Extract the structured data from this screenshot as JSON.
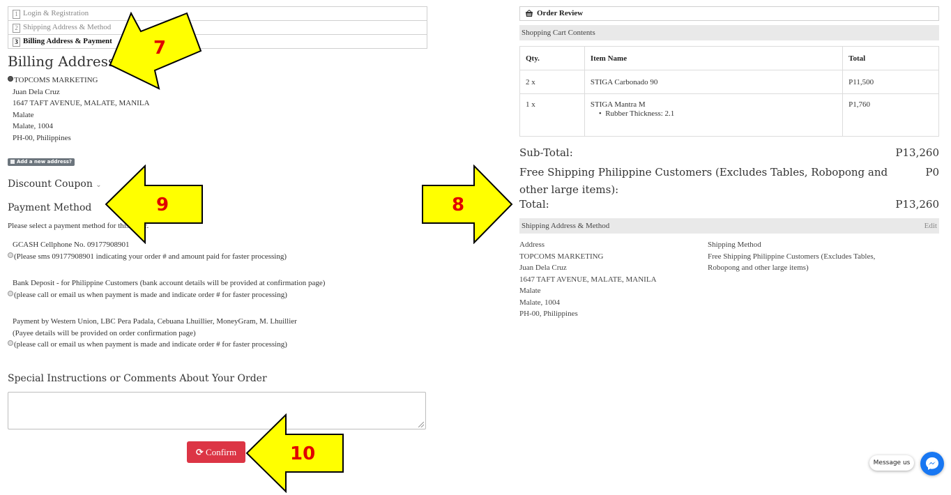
{
  "steps": [
    {
      "num": "1",
      "label": "Login & Registration"
    },
    {
      "num": "2",
      "label": "Shipping Address & Method"
    },
    {
      "num": "3",
      "label": "Billing Address & Payment"
    }
  ],
  "billing": {
    "title": "Billing Address:",
    "company": "TOPCOMS MARKETING",
    "lines": [
      "Juan Dela Cruz",
      "1647 TAFT AVENUE, MALATE, MANILA",
      "Malate",
      "Malate, 1004",
      "PH-00, Philippines"
    ],
    "add_new": "Add a new address?"
  },
  "coupon": {
    "label": "Discount Coupon"
  },
  "payment": {
    "title": "Payment Method",
    "instruction": "Please select a payment method for this order.",
    "options": [
      {
        "title": "GCASH Cellphone No. 09177908901",
        "note": "(Please sms 09177908901 indicating your order # and amount paid for faster processing)"
      },
      {
        "title": "Bank Deposit - for Philippine Customers (bank account details will be provided at confirmation page)",
        "note": "(please call or email us when payment is made and indicate order # for faster processing)"
      },
      {
        "title": "Payment by Western Union, LBC Pera Padala, Cebuana Lhuillier, MoneyGram, M. Lhuillier",
        "title2": "(Payee details will be provided on order confirmation page)",
        "note": "(please call or email us when payment is made and indicate order # for faster processing)"
      }
    ]
  },
  "comments": {
    "title": "Special Instructions or Comments About Your Order"
  },
  "confirm_label": "Confirm",
  "review": {
    "title": "Order Review",
    "cart_title": "Shopping Cart Contents",
    "columns": [
      "Qty.",
      "Item Name",
      "Total"
    ],
    "rows": [
      {
        "qty": "2 x",
        "name": "STIGA Carbonado 90",
        "total": "P11,500",
        "option": ""
      },
      {
        "qty": "1 x",
        "name": "STIGA Mantra M",
        "total": "P1,760",
        "option": "Rubber Thickness: 2.1"
      }
    ],
    "subtotal_label": "Sub-Total:",
    "subtotal_value": "P13,260",
    "shipping_label": "Free Shipping Philippine Customers (Excludes Tables, Robopong and other large items):",
    "shipping_value": "P0",
    "total_label": "Total:",
    "total_value": "P13,260",
    "ship_section": "Shipping Address & Method",
    "edit": "Edit",
    "address_heading": "Address",
    "address_lines": [
      "TOPCOMS MARKETING",
      "Juan Dela Cruz",
      "1647 TAFT AVENUE, MALATE, MANILA",
      "Malate",
      "Malate, 1004",
      "PH-00, Philippines"
    ],
    "method_heading": "Shipping Method",
    "method_lines": [
      "Free Shipping Philippine Customers (Excludes Tables,",
      "Robopong and other large items)"
    ]
  },
  "annotations": [
    "7",
    "8",
    "9",
    "10"
  ],
  "chat": {
    "label": "Message us"
  },
  "colors": {
    "confirm": "#dc3545",
    "arrow_fill": "#ffff00",
    "arrow_number": "#e00000",
    "messenger": "#1877f2"
  }
}
